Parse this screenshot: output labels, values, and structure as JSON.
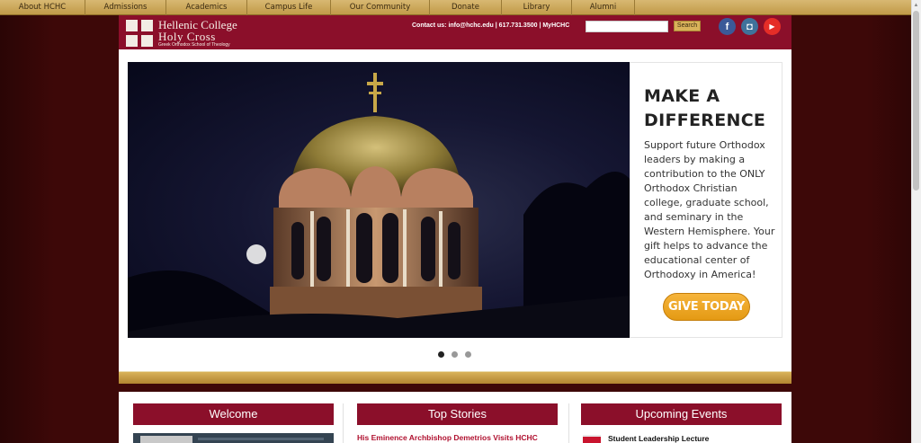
{
  "nav": {
    "items": [
      {
        "label": "About HCHC"
      },
      {
        "label": "Admissions"
      },
      {
        "label": "Academics"
      },
      {
        "label": "Campus Life"
      },
      {
        "label": "Our Community"
      },
      {
        "label": "Donate"
      },
      {
        "label": "Library"
      },
      {
        "label": "Alumni"
      }
    ]
  },
  "header": {
    "logo_line1": "Hellenic College",
    "logo_line2": "Holy Cross",
    "logo_line3": "Greek Orthodox School of Theology",
    "contact": "Contact us: info@hchc.edu | 617.731.3500 | MyHCHC",
    "search_placeholder": "",
    "search_button": "Search",
    "social": [
      {
        "icon": "facebook-icon",
        "glyph": "f",
        "color": "#3b5998"
      },
      {
        "icon": "instagram-icon",
        "glyph": "◘",
        "color": "#3f729b"
      },
      {
        "icon": "youtube-icon",
        "glyph": "▶",
        "color": "#e52d27"
      }
    ]
  },
  "hero": {
    "title": "MAKE A DIFFERENCE",
    "body": "Support future Orthodox leaders by making a contribution to the ONLY Orthodox Christian college, graduate school, and seminary in the Western Hemisphere. Your gift helps to advance the educational center of Orthodoxy in America!",
    "cta": "GIVE TODAY",
    "active_slide": 1,
    "slides": 3
  },
  "sections": {
    "welcome": "Welcome",
    "top_stories": "Top Stories",
    "upcoming_events": "Upcoming Events",
    "story_1": "His Eminence Archbishop Demetrios Visits HCHC",
    "event_1": "Student Leadership Lecture"
  },
  "colors": {
    "brand_maroon": "#8b0f2a",
    "gold": "#d9b25a",
    "cta_orange": "#f0a82a"
  }
}
